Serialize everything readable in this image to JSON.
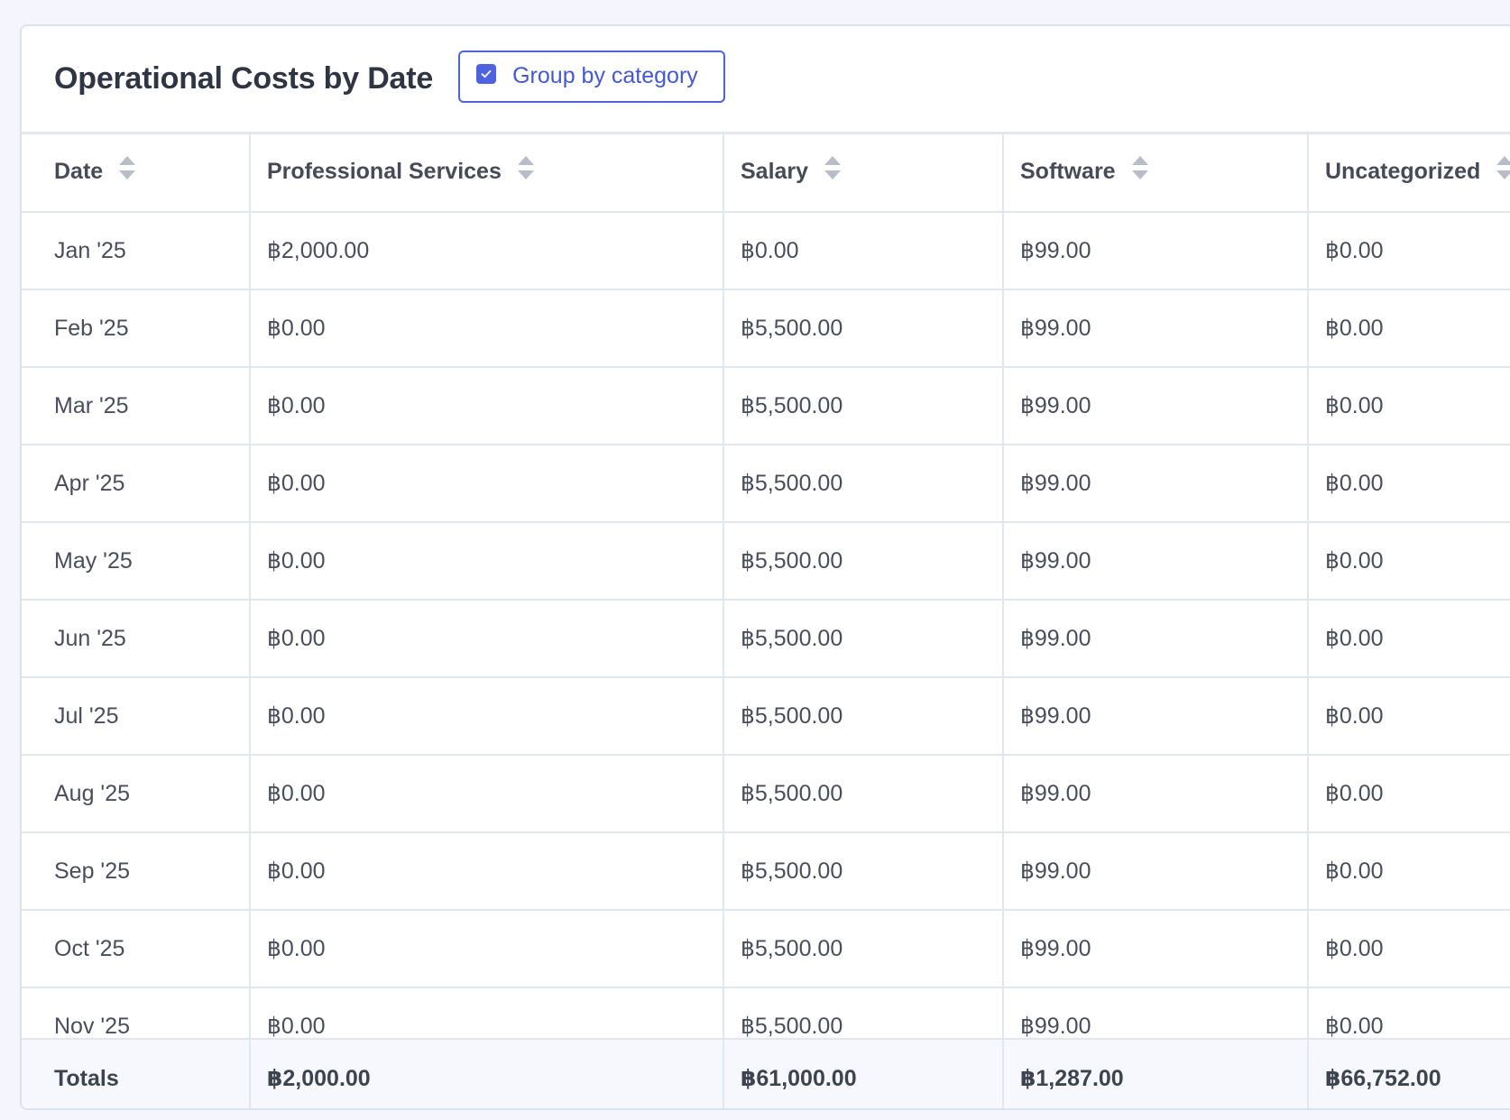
{
  "header": {
    "title": "Operational Costs by Date",
    "group_toggle_label": "Group by category",
    "group_toggle_checked": true
  },
  "table": {
    "columns": [
      "Date",
      "Professional Services",
      "Salary",
      "Software",
      "Uncategorized"
    ],
    "rows": [
      [
        "Jan '25",
        "฿2,000.00",
        "฿0.00",
        "฿99.00",
        "฿0.00"
      ],
      [
        "Feb '25",
        "฿0.00",
        "฿5,500.00",
        "฿99.00",
        "฿0.00"
      ],
      [
        "Mar '25",
        "฿0.00",
        "฿5,500.00",
        "฿99.00",
        "฿0.00"
      ],
      [
        "Apr '25",
        "฿0.00",
        "฿5,500.00",
        "฿99.00",
        "฿0.00"
      ],
      [
        "May '25",
        "฿0.00",
        "฿5,500.00",
        "฿99.00",
        "฿0.00"
      ],
      [
        "Jun '25",
        "฿0.00",
        "฿5,500.00",
        "฿99.00",
        "฿0.00"
      ],
      [
        "Jul '25",
        "฿0.00",
        "฿5,500.00",
        "฿99.00",
        "฿0.00"
      ],
      [
        "Aug '25",
        "฿0.00",
        "฿5,500.00",
        "฿99.00",
        "฿0.00"
      ],
      [
        "Sep '25",
        "฿0.00",
        "฿5,500.00",
        "฿99.00",
        "฿0.00"
      ],
      [
        "Oct '25",
        "฿0.00",
        "฿5,500.00",
        "฿99.00",
        "฿0.00"
      ],
      [
        "Nov '25",
        "฿0.00",
        "฿5,500.00",
        "฿99.00",
        "฿0.00"
      ]
    ],
    "totals": [
      "Totals",
      "฿2,000.00",
      "฿61,000.00",
      "฿1,287.00",
      "฿66,752.00"
    ]
  },
  "colors": {
    "accent": "#4d63e0",
    "border": "#e2e6ee",
    "background": "#f5f5fd"
  },
  "icons": {
    "sort": "sort-icon",
    "checkbox": "checkbox-checked-icon"
  }
}
